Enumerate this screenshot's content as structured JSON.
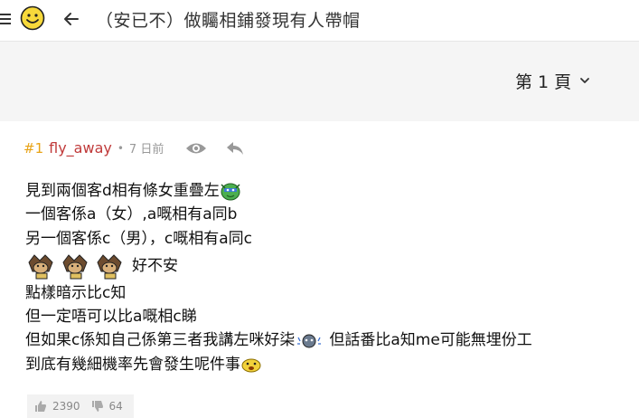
{
  "header": {
    "title": "（安已不）做矚相鋪發現有人帶帽",
    "icons": [
      "menu-icon",
      "smiley-logo-icon",
      "back-arrow-icon"
    ]
  },
  "pagination": {
    "current_page_label": "第 1 頁",
    "icon": "chevron-down-icon"
  },
  "post": {
    "floor": "#1",
    "username": "fly_away",
    "separator": "•",
    "time": "7 日前",
    "action_icons": [
      "eye-icon",
      "reply-icon"
    ],
    "lines": {
      "l1": "見到兩個客d相有條女重疊左",
      "l2": "一個客係a（女）,a嘅相有a同b",
      "l3": "另一個客係c（男），c嘅相有a同c",
      "l4": "好不安",
      "l5": "點樣暗示比c知",
      "l6": "但一定唔可以比a嘅相c睇",
      "l7a": "但如果c係知自己係第三者我講左咪好柒",
      "l7b": "但話番比a知me可能無埋份工",
      "l8": "到底有幾細機率先會發生呢件事"
    },
    "votes": {
      "up": "2390",
      "down": "64"
    },
    "colors": {
      "floor": "#e8a317",
      "username": "#c03a3a",
      "meta": "#999999"
    }
  }
}
